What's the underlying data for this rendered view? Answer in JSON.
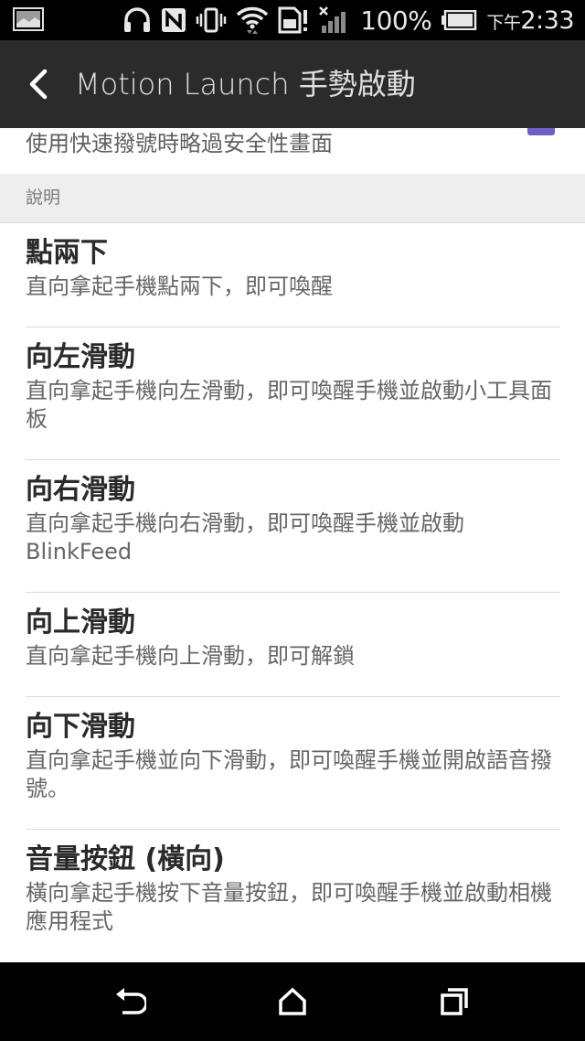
{
  "status_bar": {
    "battery_percent": "100%",
    "time_ampm": "下午",
    "time": "2:33",
    "icons": [
      "gallery-icon",
      "headset-icon",
      "nfc-icon",
      "vibrate-icon",
      "wifi-icon",
      "sim-alert-icon",
      "signal-icon",
      "battery-icon"
    ]
  },
  "app_bar": {
    "back_icon": "chevron-left-icon",
    "title": "Motion Launch 手勢啟動"
  },
  "partial_item": {
    "text": "使用快速撥號時略過安全性畫面",
    "checkbox_color": "#6d5fc8"
  },
  "section": {
    "header": "說明"
  },
  "items": [
    {
      "title": "點兩下",
      "desc": "直向拿起手機點兩下，即可喚醒"
    },
    {
      "title": "向左滑動",
      "desc": "直向拿起手機向左滑動，即可喚醒手機並啟動小工具面板"
    },
    {
      "title": "向右滑動",
      "desc": "直向拿起手機向右滑動，即可喚醒手機並啟動BlinkFeed"
    },
    {
      "title": "向上滑動",
      "desc": "直向拿起手機向上滑動，即可解鎖"
    },
    {
      "title": "向下滑動",
      "desc": "直向拿起手機並向下滑動，即可喚醒手機並開啟語音撥號。"
    },
    {
      "title": "音量按鈕 (橫向)",
      "desc": "橫向拿起手機按下音量按鈕，即可喚醒手機並啟動相機應用程式"
    }
  ],
  "nav_bar": {
    "back_icon": "nav-back-icon",
    "home_icon": "nav-home-icon",
    "recents_icon": "nav-recents-icon"
  },
  "colors": {
    "status_bar": "#000000",
    "app_bar": "#2b2b2b",
    "section_header_bg": "#eeeeee",
    "accent": "#6d5fc8"
  }
}
